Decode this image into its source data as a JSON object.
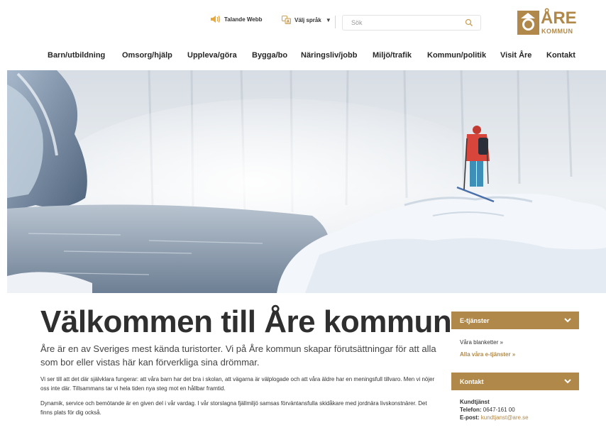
{
  "header": {
    "talande_webb": "Talande Webb",
    "language": "Välj språk",
    "language_caret": "▼",
    "search_placeholder": "Sök"
  },
  "logo": {
    "name": "ÅRE",
    "sub": "KOMMUN"
  },
  "nav": [
    "Barn/utbildning",
    "Omsorg/hjälp",
    "Uppleva/göra",
    "Bygga/bo",
    "Näringsliv/jobb",
    "Miljö/trafik",
    "Kommun/politik",
    "Visit Åre",
    "Kontakt"
  ],
  "main": {
    "title": "Välkommen till Åre kommun",
    "ingress": "Åre är en av Sveriges mest kända turistorter. Vi på Åre kommun skapar förutsättningar för att alla som bor eller vistas här kan förverkliga sina drömmar.",
    "paragraphs": [
      "Vi ser till att det där självklara fungerar: att våra barn har det bra i skolan, att vägarna är välplogade och att våra äldre har en meningsfull tillvaro. Men vi nöjer oss inte där. Tillsammans tar vi hela tiden nya steg mot en hållbar framtid.",
      "Dynamik, service och bemötande är en given del i vår vardag. I vår storslagna fjällmiljö samsas förväntansfulla skidåkare med jordnära livskonstnärer. Det finns plats för dig också."
    ]
  },
  "sidebar": {
    "eservices": {
      "title": "E-tjänster",
      "link1": "Våra blanketter »",
      "link2": "Alla våra e-tjänster »"
    },
    "contact": {
      "title": "Kontakt",
      "name": "Kundtjänst",
      "phone_label": "Telefon:",
      "phone": "0647-161 00",
      "email_label": "E-post:",
      "email": "kundtjanst@are.se"
    }
  },
  "colors": {
    "brand_gold": "#b0894a",
    "text_dark": "#2f2f2f"
  }
}
